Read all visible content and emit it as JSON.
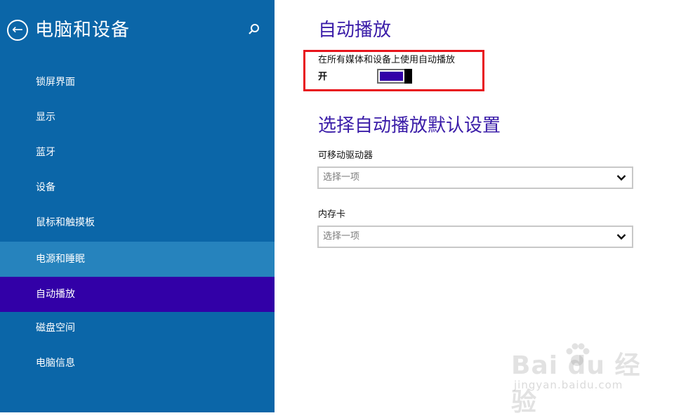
{
  "sidebar": {
    "title": "电脑和设备",
    "items": [
      {
        "label": "锁屏界面"
      },
      {
        "label": "显示"
      },
      {
        "label": "蓝牙"
      },
      {
        "label": "设备"
      },
      {
        "label": "鼠标和触摸板"
      },
      {
        "label": "电源和睡眠"
      },
      {
        "label": "自动播放"
      },
      {
        "label": "磁盘空间"
      },
      {
        "label": "电脑信息"
      }
    ],
    "hovered_index": 5,
    "selected_index": 6
  },
  "main": {
    "title": "自动播放",
    "autoplay_setting": {
      "label": "在所有媒体和设备上使用自动播放",
      "state_label": "开",
      "enabled": true
    },
    "defaults_title": "选择自动播放默认设置",
    "removable_drive": {
      "label": "可移动驱动器",
      "value": "选择一项"
    },
    "memory_card": {
      "label": "内存卡",
      "value": "选择一项"
    }
  },
  "watermark": {
    "brand": "Bai du 经验",
    "url": "jingyan.baidu.com"
  },
  "colors": {
    "sidebar_bg": "#0b66a8",
    "sidebar_hover": "#2683bd",
    "sidebar_selected": "#3200a7",
    "accent_title": "#3a1ca8",
    "toggle_fill": "#3200a7",
    "highlight_border": "#e8141c"
  },
  "icons": {
    "back": "back-arrow-icon",
    "search": "search-icon",
    "chevron": "chevron-down-icon"
  }
}
